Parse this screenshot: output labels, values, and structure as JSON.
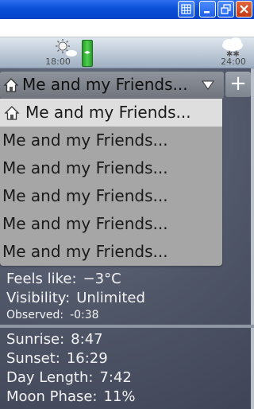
{
  "titlebar": {
    "buttons": [
      "grid",
      "minimize",
      "maximize",
      "close"
    ]
  },
  "forecast": [
    {
      "time": "18:00",
      "icon": "partly-sunny-icon"
    },
    {
      "time": "24:00",
      "icon": "snow-cloud-icon"
    }
  ],
  "location": {
    "title": "Me and my Friends...",
    "add_label": "+"
  },
  "dropdown": {
    "items": [
      "Me and my Friends...",
      "Me and my Friends...",
      "Me and my Friends...",
      "Me and my Friends...",
      "Me and my Friends...",
      "Me and my Friends..."
    ],
    "selected_index": 0
  },
  "details": {
    "feels_like": {
      "label": "Feels like:",
      "value": "−3°C"
    },
    "visibility": {
      "label": "Visibility:",
      "value": "Unlimited"
    },
    "observed": {
      "label": "Observed:",
      "value": "-0:38"
    },
    "sunrise": {
      "label": "Sunrise:",
      "value": "8:47"
    },
    "sunset": {
      "label": "Sunset:",
      "value": "16:29"
    },
    "day_length": {
      "label": "Day Length:",
      "value": "7:42"
    },
    "moon_phase": {
      "label": "Moon Phase:",
      "value": "11%"
    }
  },
  "colors": {
    "titlebar": "#0a4fd8",
    "close": "#c23a14",
    "handle": "#3ab83a",
    "panel": "#4f5668"
  }
}
